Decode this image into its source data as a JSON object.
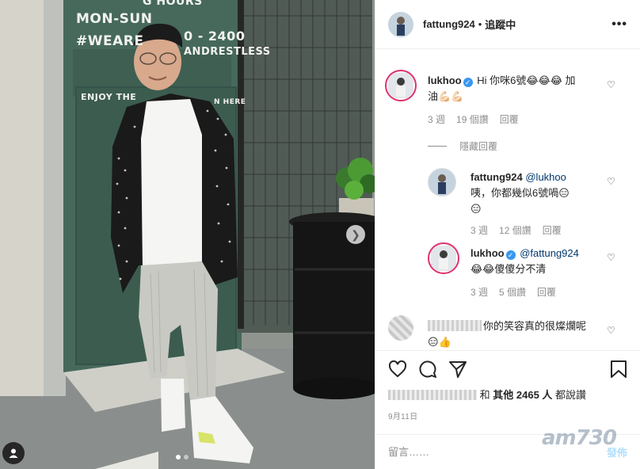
{
  "photo": {
    "sign_lines": [
      "G HOURS",
      "MON-SUN",
      "0 - 2400",
      "#WEARE",
      "ANDRESTLESS",
      "ENJOY THE",
      "N HERE"
    ],
    "next_icon": "chevron-right-icon",
    "user_tag_icon": "person-icon",
    "carousel_dots": 2
  },
  "header": {
    "username": "fattung924",
    "separator": "•",
    "follow_label": "追蹤中",
    "more_icon": "•••"
  },
  "comments": [
    {
      "username": "lukhoo",
      "verified": true,
      "text_line1": "Hi 你咪6號😂😂😂 加",
      "text_line2": "油💪🏻💪🏻",
      "time": "3 週",
      "likes": "19 個讚",
      "reply": "回覆"
    },
    {
      "hide_replies": "隱藏回覆"
    },
    {
      "username": "fattung924",
      "mention": "@lukhoo",
      "text_line1": "咦，你都幾似6號喎😑",
      "text_line2": "😑",
      "time": "3 週",
      "likes": "12 個讚",
      "reply": "回覆"
    },
    {
      "username": "lukhoo",
      "verified": true,
      "mention": "@fattung924",
      "text_line1": "😂😂傻傻分不清",
      "time": "3 週",
      "likes": "5 個讚",
      "reply": "回覆"
    },
    {
      "text_line1": "你的笑容真的很燦爛呢",
      "text_line2": "😑👍"
    }
  ],
  "actions": {
    "like_icon": "heart-icon",
    "comment_icon": "comment-icon",
    "share_icon": "send-icon",
    "save_icon": "bookmark-icon"
  },
  "likes_line": {
    "others_label": "其他 2465 人",
    "and": "和",
    "suffix": "都說讚"
  },
  "date": "9月11日",
  "add_comment": {
    "placeholder": "留言……",
    "post_label": "發佈"
  },
  "watermark": "am730"
}
